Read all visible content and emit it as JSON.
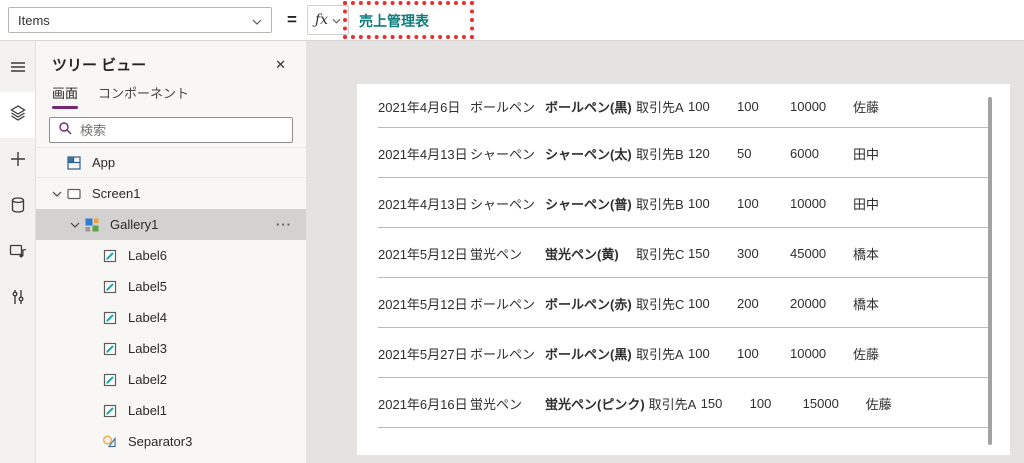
{
  "colors": {
    "accent_purple": "#742774",
    "formula_teal": "#0f7c7c",
    "annotation_red": "#ee2c2c",
    "separator_blue": "#a9bddd"
  },
  "formula_bar": {
    "property_selector": "Items",
    "equals_sign": "=",
    "fx_label": "ƒx",
    "formula": "売上管理表"
  },
  "left_rail": {
    "items": [
      {
        "name": "hamburger-menu-icon",
        "selected": false
      },
      {
        "name": "tree-view-icon",
        "selected": true
      },
      {
        "name": "insert-plus-icon",
        "selected": false
      },
      {
        "name": "data-icon",
        "selected": false
      },
      {
        "name": "media-icon",
        "selected": false
      },
      {
        "name": "advanced-tools-icon",
        "selected": false
      }
    ]
  },
  "tree_panel": {
    "title": "ツリー ビュー",
    "close_glyph": "✕",
    "tabs": [
      {
        "name": "tab-screens",
        "label": "画面",
        "active": true
      },
      {
        "name": "tab-components",
        "label": "コンポーネント",
        "active": false
      }
    ],
    "search_placeholder": "検索",
    "items": [
      {
        "label": "App",
        "icon": "app-icon",
        "level": 0,
        "chevron": false,
        "selected": false,
        "bordered": true
      },
      {
        "label": "Screen1",
        "icon": "screen-icon",
        "level": 0,
        "chevron": true,
        "selected": false
      },
      {
        "label": "Gallery1",
        "icon": "gallery-icon",
        "level": 1,
        "chevron": true,
        "selected": true,
        "menu": "···"
      },
      {
        "label": "Label6",
        "icon": "label-icon",
        "level": 2,
        "chevron": false,
        "selected": false
      },
      {
        "label": "Label5",
        "icon": "label-icon",
        "level": 2,
        "chevron": false,
        "selected": false
      },
      {
        "label": "Label4",
        "icon": "label-icon",
        "level": 2,
        "chevron": false,
        "selected": false
      },
      {
        "label": "Label3",
        "icon": "label-icon",
        "level": 2,
        "chevron": false,
        "selected": false
      },
      {
        "label": "Label2",
        "icon": "label-icon",
        "level": 2,
        "chevron": false,
        "selected": false
      },
      {
        "label": "Label1",
        "icon": "label-icon",
        "level": 2,
        "chevron": false,
        "selected": false
      },
      {
        "label": "Separator3",
        "icon": "separator-icon",
        "level": 2,
        "chevron": false,
        "selected": false
      }
    ]
  },
  "canvas": {
    "gallery_columns": [
      "date",
      "category",
      "product",
      "client",
      "unit-price",
      "quantity",
      "amount",
      "person"
    ],
    "gallery_rows": [
      [
        "2021年4月6日",
        "ボールペン",
        "ボールペン(黒)",
        "取引先A",
        "100",
        "100",
        "10000",
        "佐藤"
      ],
      [
        "2021年4月13日",
        "シャーペン",
        "シャーペン(太)",
        "取引先B",
        "120",
        "50",
        "6000",
        "田中"
      ],
      [
        "2021年4月13日",
        "シャーペン",
        "シャーペン(普)",
        "取引先B",
        "100",
        "100",
        "10000",
        "田中"
      ],
      [
        "2021年5月12日",
        "蛍光ペン",
        "蛍光ペン(黄)",
        "取引先C",
        "150",
        "300",
        "45000",
        "橋本"
      ],
      [
        "2021年5月12日",
        "ボールペン",
        "ボールペン(赤)",
        "取引先C",
        "100",
        "200",
        "20000",
        "橋本"
      ],
      [
        "2021年5月27日",
        "ボールペン",
        "ボールペン(黒)",
        "取引先A",
        "100",
        "100",
        "10000",
        "佐藤"
      ],
      [
        "2021年6月16日",
        "蛍光ペン",
        "蛍光ペン(ピンク)",
        "取引先A",
        "150",
        "100",
        "15000",
        "佐藤"
      ]
    ]
  }
}
